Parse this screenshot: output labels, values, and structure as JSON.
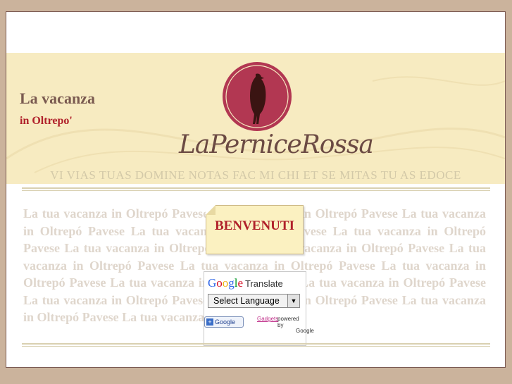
{
  "header": {
    "tagline_title": "La vacanza",
    "tagline_sub": "in Oltrepo'",
    "logo_text": "LaPerniceRossa",
    "motto": "VI VIAS TUAS DOMINE NOTAS FAC MI CHI ET SE MITAS TU AS EDOCE"
  },
  "content": {
    "background_text": "La tua vacanza in Oltrepó Pavese La tua vacanza in Oltrepó Pavese La tua vacanza in Oltrepó Pavese La tua vacanza in Oltrepó Pavese La tua vacanza in Oltrepó Pavese La tua vacanza in Oltrepó Pavese La tua vacanza in Oltrepó Pavese La tua vacanza in Oltrepó Pavese La tua vacanza in Oltrepó Pavese La tua vacanza in Oltrepó Pavese La tua vacanza in Oltrepó Pavese La tua vacanza in Oltrepó Pavese La tua vacanza in Oltrepó Pavese La tua vacanza in Oltrepó Pavese La tua vacanza in Oltrepó Pavese La tua vacanza in Oltre",
    "welcome": "BENVENUTI"
  },
  "translate": {
    "logo": "Google",
    "label": "Translate",
    "select_value": "Select Language",
    "gadget_button": "Google",
    "gadgets_link": "Gadgets",
    "powered_by": "powered by",
    "powered_google": "Google"
  },
  "colors": {
    "page_bg": "#cbb39c",
    "header_bg": "#f7ebc1",
    "accent_red": "#b0202a",
    "brown_text": "#7a5a50"
  }
}
